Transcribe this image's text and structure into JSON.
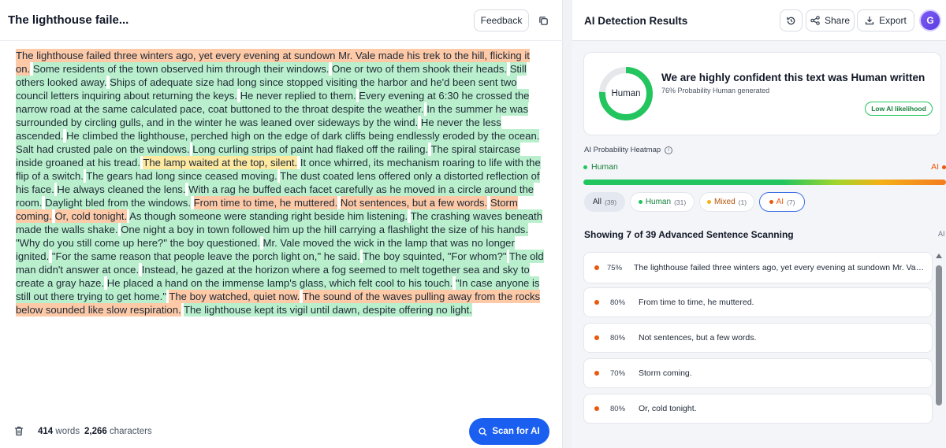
{
  "left": {
    "title": "The lighthouse faile...",
    "feedback_label": "Feedback",
    "segments": [
      {
        "t": "ai",
        "text": "The lighthouse failed three winters ago, yet every evening at sundown Mr. Vale made his trek to the hill, flicking it on."
      },
      {
        "t": "human",
        "text": "Some residents of the town observed him through their windows."
      },
      {
        "t": "human",
        "text": "One or two of them shook their heads."
      },
      {
        "t": "human",
        "text": "Still others looked away."
      },
      {
        "t": "human",
        "text": "Ships of adequate size had long since stopped visiting the harbor and he'd been sent two council letters inquiring about re­turning the keys."
      },
      {
        "t": "human",
        "text": "He never replied to them."
      },
      {
        "t": "human",
        "text": "Every evening at 6:30 he crossed the narrow road at the same calculated pace, coat buttoned to the throat despite the weather."
      },
      {
        "t": "human",
        "text": "In the summer he was surrounded by circling gulls, and in the winter he was leaned over sideways by the wind."
      },
      {
        "t": "human",
        "text": "He never the less ascended."
      },
      {
        "t": "human",
        "text": "He climbed the lighthouse, perched high on the edge of dark cliffs being endlessly eroded by the ocean."
      },
      {
        "t": "human",
        "text": "Salt had crusted pale on the windows."
      },
      {
        "t": "human",
        "text": "Long curling strips of paint had flaked off the railing."
      },
      {
        "t": "human",
        "text": "The spiral staircase inside groaned at his tread."
      },
      {
        "t": "mixed",
        "text": "The lamp waited at the top, silent."
      },
      {
        "t": "human",
        "text": "It once whirred, its mechanism roaring to life with the flip of a switch."
      },
      {
        "t": "human",
        "text": "The gears had long since ceased moving."
      },
      {
        "t": "human",
        "text": "The dust coated lens offered only a distorted reflection of his face."
      },
      {
        "t": "human",
        "text": "He always cleaned the lens."
      },
      {
        "t": "human",
        "text": "With a rag he buffed each facet carefully as he moved in a circle around the room."
      },
      {
        "t": "human",
        "text": "Daylight bled from the windows."
      },
      {
        "t": "ai",
        "text": "From time to time, he muttered."
      },
      {
        "t": "ai",
        "text": "Not sentences, but a few words."
      },
      {
        "t": "ai",
        "text": "Storm coming."
      },
      {
        "t": "ai",
        "text": "Or, cold tonight."
      },
      {
        "t": "human",
        "text": "As though someone were standing right beside him listening."
      },
      {
        "t": "human",
        "text": "The crashing waves beneath made the walls shake."
      },
      {
        "t": "human",
        "text": "One night a boy in town followed him up the hill carrying a flashlight the size of his hands."
      },
      {
        "t": "human",
        "text": "\"Why do you still come up here?\" the boy questioned."
      },
      {
        "t": "human",
        "text": "Mr. Vale moved the wick in the lamp that was no longer ignited."
      },
      {
        "t": "human",
        "text": "\"For the same reason that people leave the porch light on,\" he said."
      },
      {
        "t": "human",
        "text": "The boy squinted, \"For whom?\""
      },
      {
        "t": "human",
        "text": "The old man didn't answer at once."
      },
      {
        "t": "human",
        "text": "Instead, he gazed at the horizon where a fog seemed to melt together sea and sky to create a gray haze."
      },
      {
        "t": "human",
        "text": "He placed a hand on the immense lamp's glass, which felt cool to his touch."
      },
      {
        "t": "human",
        "text": "\"In case anyone is still out there trying to get home.\""
      },
      {
        "t": "ai",
        "text": "The boy watched, quiet now."
      },
      {
        "t": "ai",
        "text": "The sound of the waves pulling away from the rocks below sounded like slow respiration."
      },
      {
        "t": "human",
        "text": "The lighthouse kept its vigil until dawn, despite offering no light."
      }
    ],
    "words_count": "414",
    "words_label": "words",
    "chars_count": "2,266",
    "chars_label": "characters",
    "scan_label": "Scan for AI"
  },
  "right": {
    "title": "AI Detection Results",
    "share_label": "Share",
    "export_label": "Export",
    "avatar_initial": "G",
    "verdict_label": "Human",
    "human_fraction": 0.76,
    "confidence_text": "We are highly confident this text was Human written",
    "probability_text": "76% Probability Human generated",
    "likelihood_badge": "Low AI likelihood",
    "heatmap_label": "AI Probability Heatmap",
    "heatmap_left": "Human",
    "heatmap_right": "AI",
    "filters": {
      "all_label": "All",
      "all_count": "(39)",
      "human_label": "Human",
      "human_count": "(31)",
      "mixed_label": "Mixed",
      "mixed_count": "(1)",
      "ai_label": "AI",
      "ai_count": "(7)"
    },
    "showing_text": "Showing 7 of 39 Advanced Sentence Scanning",
    "corner_label": "AI",
    "sentences": [
      {
        "pct": "75%",
        "text": "The lighthouse failed three winters ago, yet every evening at sundown Mr. Vale..."
      },
      {
        "pct": "80%",
        "text": "From time to time, he muttered."
      },
      {
        "pct": "80%",
        "text": "Not sentences, but a few words."
      },
      {
        "pct": "70%",
        "text": "Storm coming."
      },
      {
        "pct": "80%",
        "text": "Or, cold tonight."
      }
    ]
  },
  "colors": {
    "human": "#22c55e",
    "ai": "#ea580c",
    "mixed": "#f5b018",
    "primary": "#1a5ff0"
  }
}
